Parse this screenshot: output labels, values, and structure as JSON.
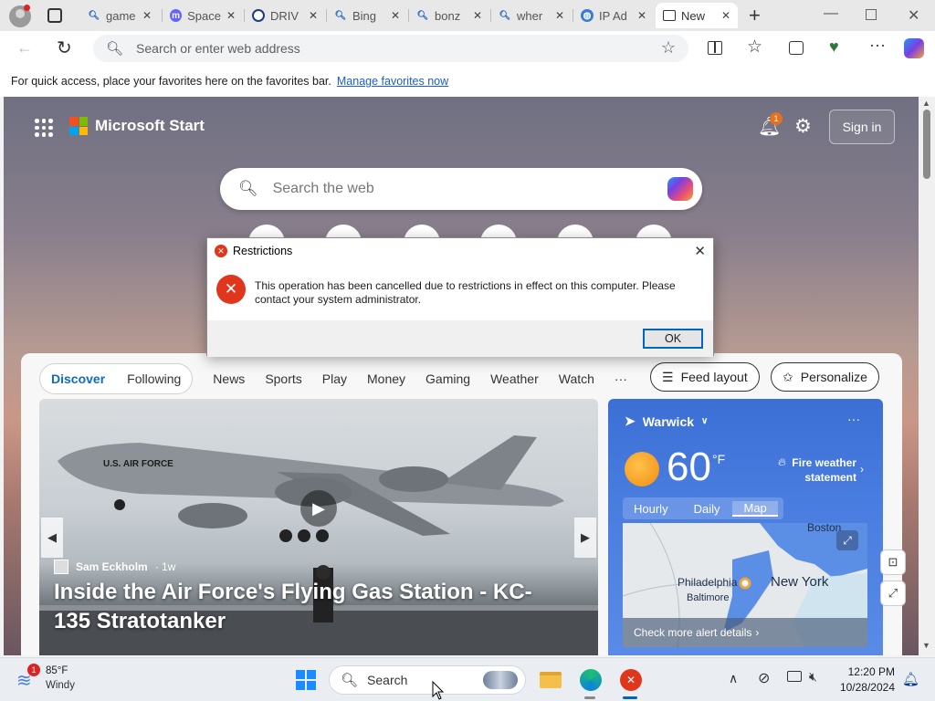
{
  "tabs": [
    {
      "label": "game",
      "icon": "search-icon"
    },
    {
      "label": "Space",
      "icon": "mastodon-icon"
    },
    {
      "label": "DRIV",
      "icon": "drive-icon"
    },
    {
      "label": "Bing",
      "icon": "search-icon"
    },
    {
      "label": "bonz",
      "icon": "search-icon"
    },
    {
      "label": "wher",
      "icon": "search-icon"
    },
    {
      "label": "IP Ad",
      "icon": "globe-icon"
    },
    {
      "label": "New",
      "icon": "newtab-icon"
    }
  ],
  "address_bar": {
    "placeholder": "Search or enter web address"
  },
  "favorites_bar": {
    "text": "For quick access, place your favorites here on the favorites bar.",
    "link": "Manage favorites now"
  },
  "page": {
    "brand": "Microsoft Start",
    "notification_count": "1",
    "sign_in": "Sign in",
    "search_placeholder": "Search the web"
  },
  "feed": {
    "pill_tabs": [
      "Discover",
      "Following"
    ],
    "tabs": [
      "News",
      "Sports",
      "Play",
      "Money",
      "Gaming",
      "Weather",
      "Watch"
    ],
    "more": "···",
    "feed_layout": "Feed layout",
    "personalize": "Personalize"
  },
  "hero": {
    "author": "Sam Eckholm",
    "age": "· 1w",
    "title": "Inside the Air Force's Flying Gas Station - KC-135 Stratotanker",
    "plane_text": "U.S. AIR FORCE"
  },
  "weather": {
    "location": "Warwick",
    "temp": "60",
    "unit": "°F",
    "alert": "Fire weather statement",
    "tabs": [
      "Hourly",
      "Daily",
      "Map"
    ],
    "map_labels": [
      "Boston",
      "Philadelphia",
      "New York",
      "Baltimore"
    ],
    "alerts_link": "Check more alert details"
  },
  "dialog": {
    "title": "Restrictions",
    "message": "This operation has been cancelled due to restrictions in effect on this computer. Please contact your system administrator.",
    "ok": "OK"
  },
  "taskbar": {
    "weather_temp": "85°F",
    "weather_desc": "Windy",
    "weather_badge": "1",
    "search": "Search",
    "time": "12:20 PM",
    "date": "10/28/2024"
  },
  "colors": {
    "accent": "#0067c0",
    "error": "#e0361c",
    "weather_bg": "#4a7de0"
  }
}
